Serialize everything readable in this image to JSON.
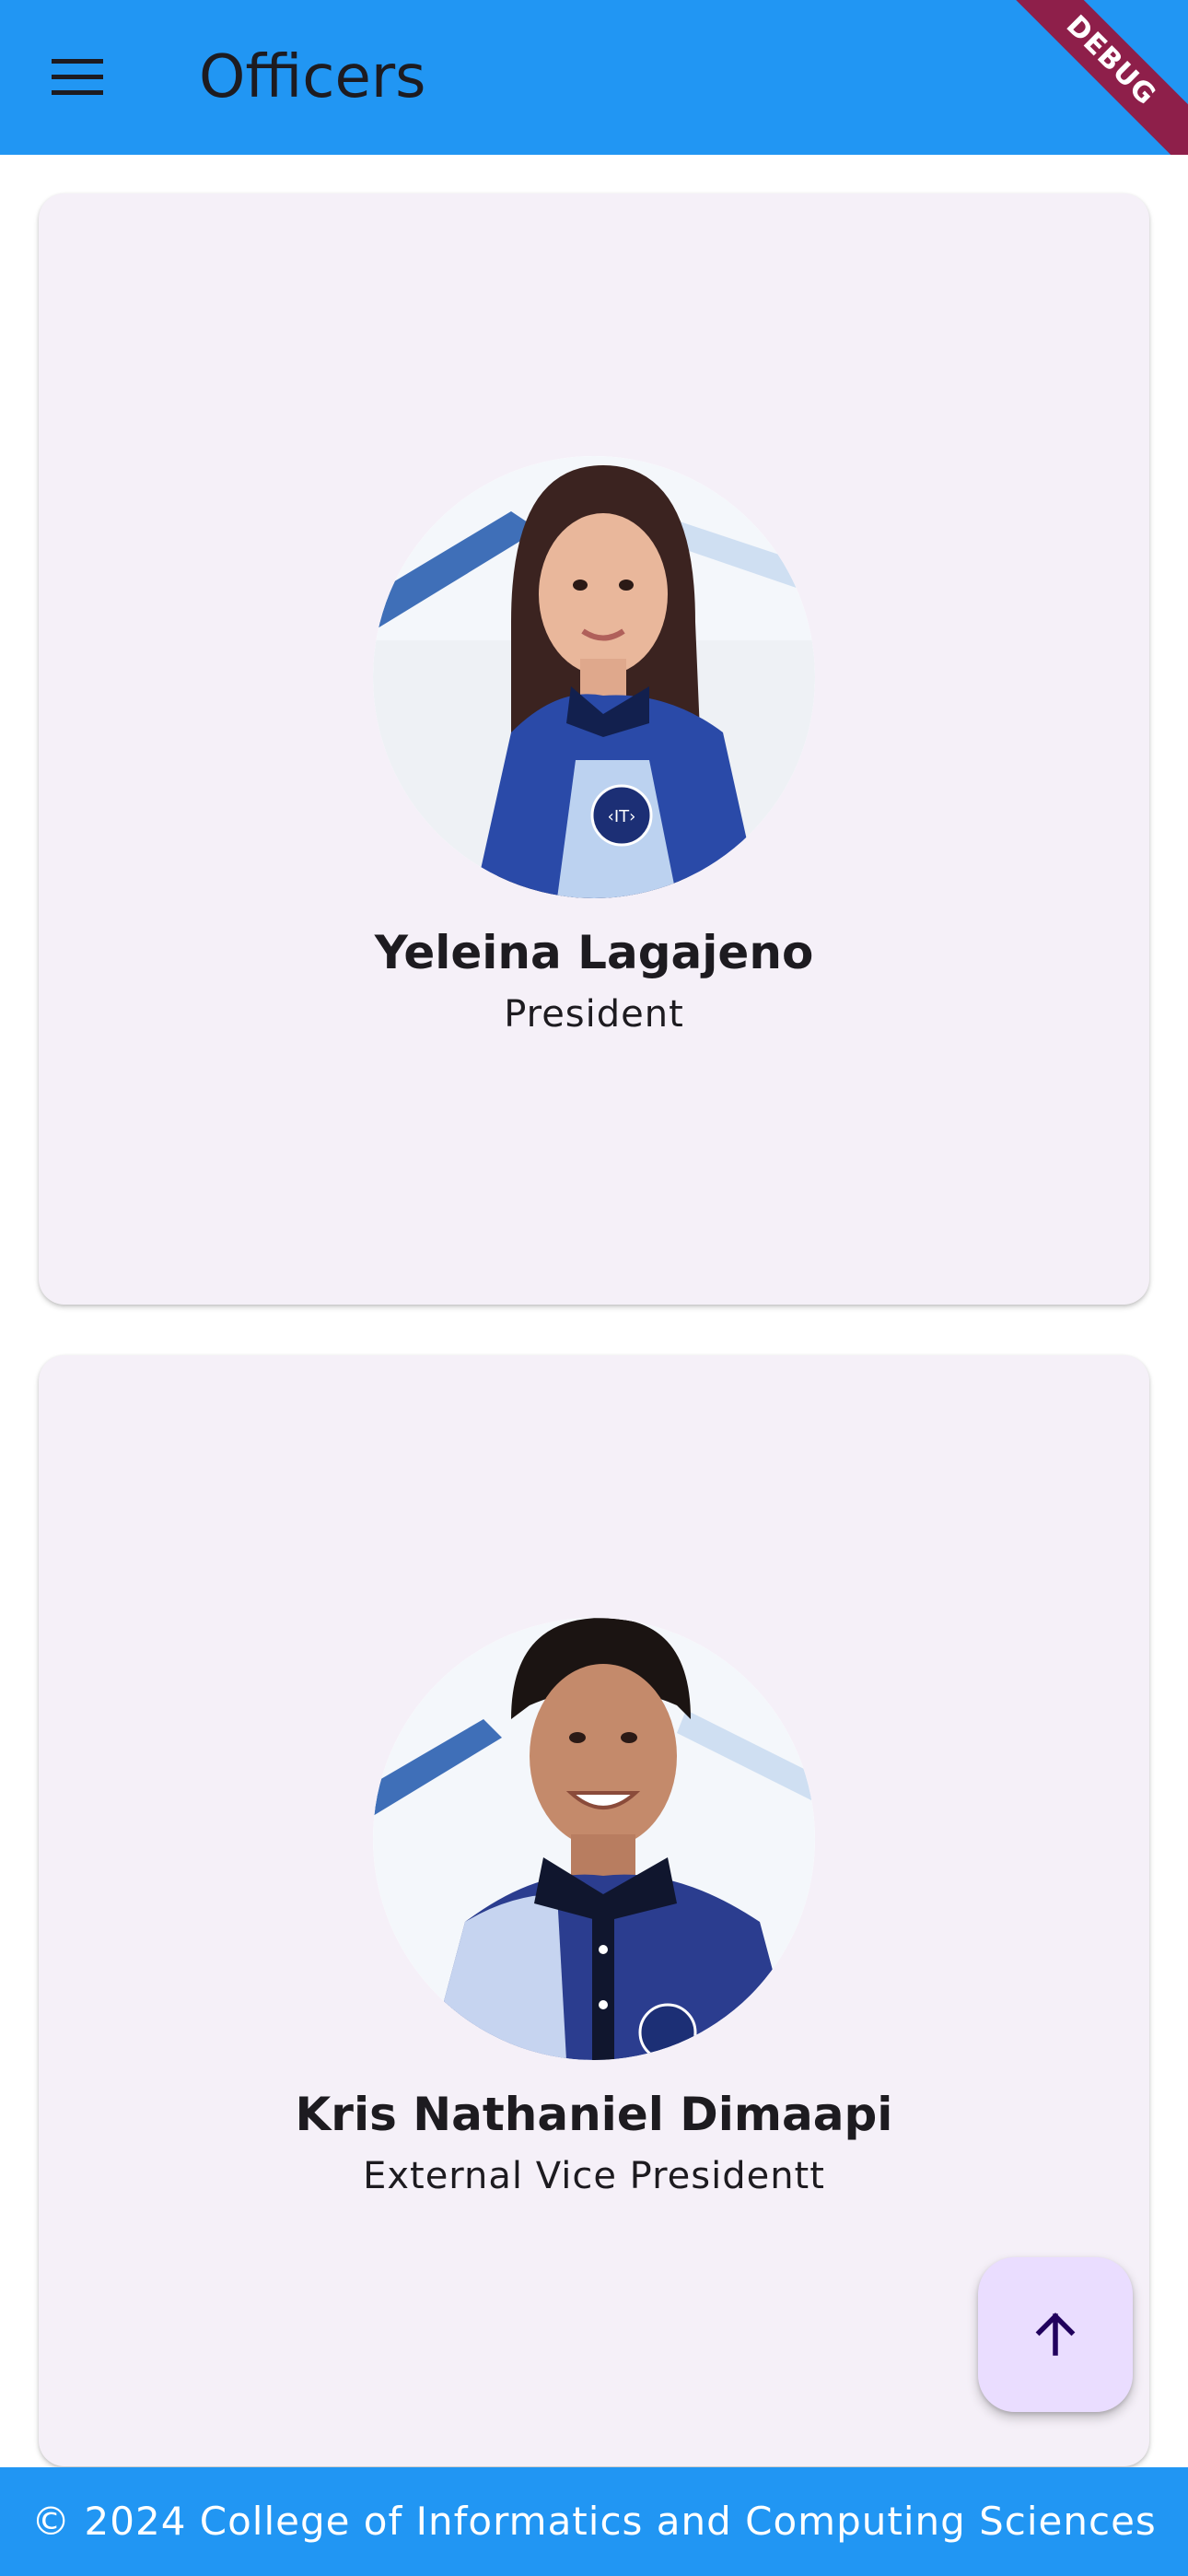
{
  "appbar": {
    "title": "Officers",
    "menu_icon": "menu-icon",
    "debug_label": "DEBUG"
  },
  "officers": [
    {
      "name": "Yeleina Lagajeno",
      "position": "President"
    },
    {
      "name": "Kris Nathaniel Dimaapi",
      "position": "External Vice Presidentt"
    }
  ],
  "fab": {
    "icon": "arrow-up-icon"
  },
  "footer": {
    "text": "© 2024 College of Informatics and Computing Sciences"
  },
  "colors": {
    "appbar": "#2196F3",
    "card_background": "#f5f0f8",
    "fab_background": "#eaddff",
    "debug_banner": "#8e1f4a"
  }
}
